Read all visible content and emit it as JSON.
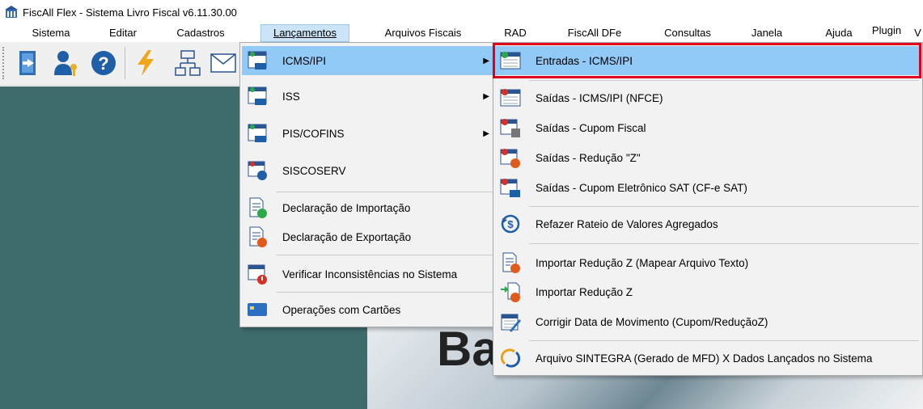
{
  "window": {
    "title": "FiscAll Flex - Sistema Livro Fiscal v6.11.30.00"
  },
  "menubar": {
    "items": [
      {
        "label": "Sistema"
      },
      {
        "label": "Editar"
      },
      {
        "label": "Cadastros"
      },
      {
        "label": "Lançamentos"
      },
      {
        "label": "Arquivos Fiscais"
      },
      {
        "label": "RAD"
      },
      {
        "label": "FiscAll DFe"
      },
      {
        "label": "Consultas"
      },
      {
        "label": "Janela"
      },
      {
        "label": "Ajuda"
      },
      {
        "label": "Plugin"
      },
      {
        "label": "V"
      }
    ]
  },
  "toolbar": {
    "buttons": [
      {
        "icon": "exit-door-icon"
      },
      {
        "icon": "user-key-icon"
      },
      {
        "icon": "help-icon"
      },
      {
        "icon": "lightning-icon"
      },
      {
        "icon": "org-chart-icon"
      },
      {
        "icon": "envelope-icon"
      }
    ]
  },
  "background": {
    "text": "Ba"
  },
  "menu_lancamentos": {
    "items": [
      {
        "label": "ICMS/IPI",
        "icon": "icms-icon",
        "submenu": true
      },
      {
        "label": "ISS",
        "icon": "iss-icon",
        "submenu": true
      },
      {
        "label": "PIS/COFINS",
        "icon": "pis-icon",
        "submenu": true
      },
      {
        "label": "SISCOSERV",
        "icon": "siscoserv-icon",
        "submenu": false
      },
      {
        "label": "Declaração de Importação",
        "icon": "import-doc-icon",
        "submenu": false
      },
      {
        "label": "Declaração de Exportação",
        "icon": "export-doc-icon",
        "submenu": false
      },
      {
        "label": "Verificar Inconsistências no Sistema",
        "icon": "warning-window-icon",
        "submenu": false
      },
      {
        "label": "Operações com Cartões",
        "icon": "card-icon",
        "submenu": false
      }
    ]
  },
  "menu_icms": {
    "items": [
      {
        "label": "Entradas - ICMS/IPI",
        "icon": "entrada-icon"
      },
      {
        "label": "Saídas - ICMS/IPI (NFCE)",
        "icon": "saida-icon"
      },
      {
        "label": "Saídas - Cupom Fiscal",
        "icon": "cupom-icon"
      },
      {
        "label": "Saídas - Redução \"Z\"",
        "icon": "reducao-z-icon"
      },
      {
        "label": "Saídas - Cupom Eletrônico SAT (CF-e SAT)",
        "icon": "sat-icon"
      },
      {
        "label": "Refazer Rateio de Valores Agregados",
        "icon": "rateio-icon"
      },
      {
        "label": "Importar Redução Z (Mapear Arquivo Texto)",
        "icon": "import-text-icon"
      },
      {
        "label": "Importar Redução Z",
        "icon": "import-z-icon"
      },
      {
        "label": "Corrigir Data de Movimento (Cupom/ReduçãoZ)",
        "icon": "calendar-edit-icon"
      },
      {
        "label": "Arquivo SINTEGRA (Gerado de MFD) X Dados Lançados no Sistema",
        "icon": "sintegra-icon"
      }
    ]
  },
  "colors": {
    "highlight": "#91c9f7",
    "menubar_active": "#cce4f7",
    "workspace": "#3e6b6c",
    "callout": "#e0001b"
  }
}
